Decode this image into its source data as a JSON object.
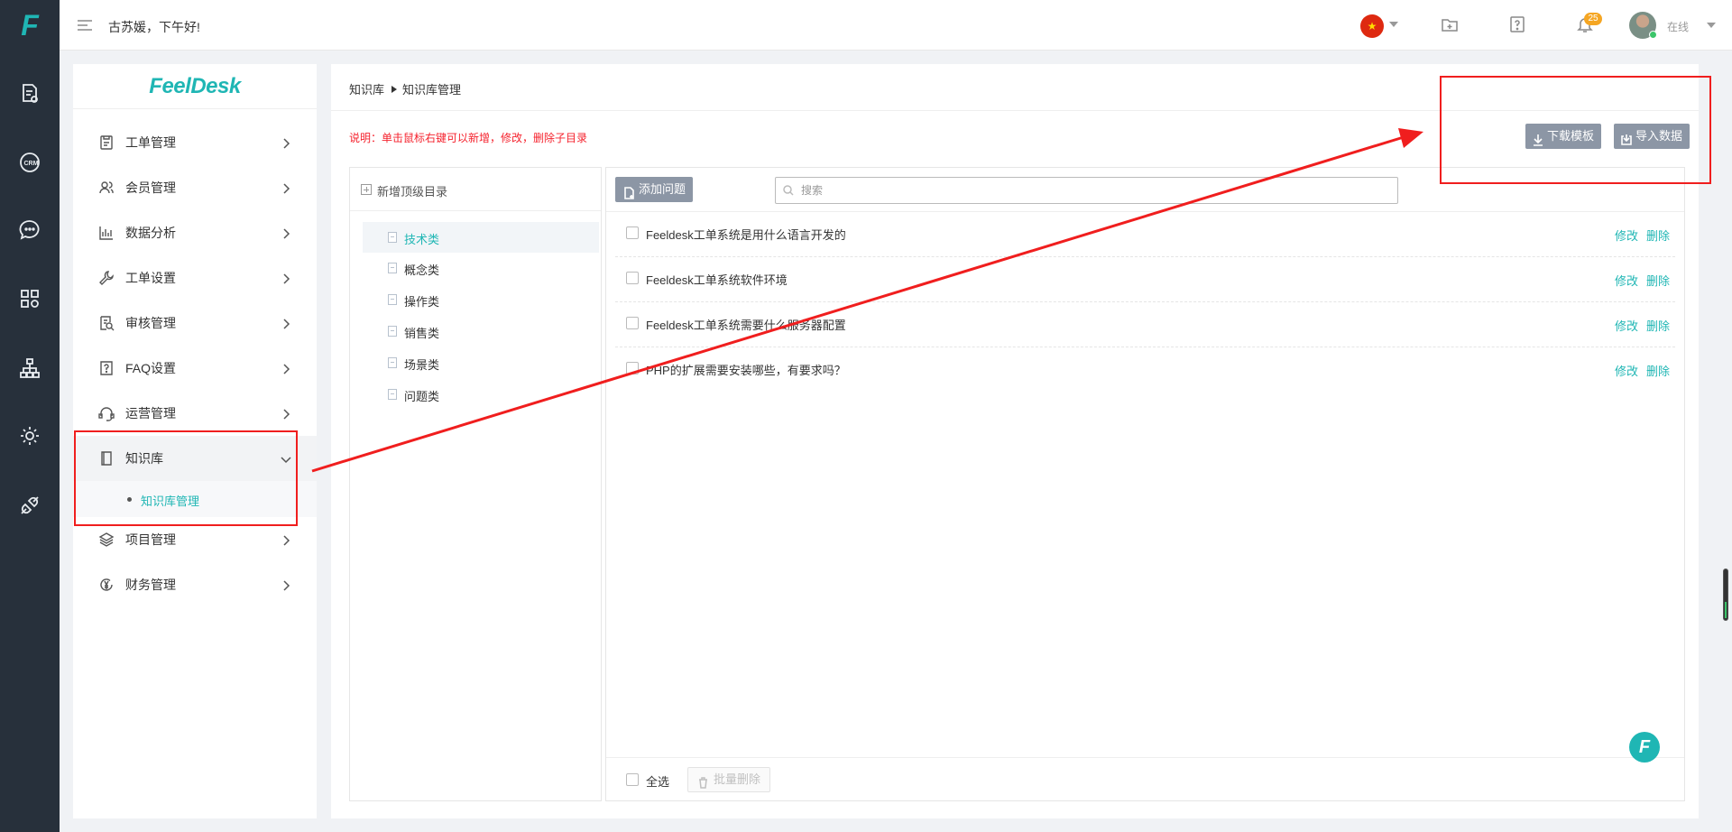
{
  "app": {
    "logo_letter": "F",
    "brand": "FeelDesk",
    "greeting": "古苏媛，下午好!"
  },
  "rail": {
    "items": [
      {
        "icon": "ticket-settings-icon"
      },
      {
        "icon": "crm-icon"
      },
      {
        "icon": "chat-bubble-icon"
      },
      {
        "icon": "apps-grid-icon"
      },
      {
        "icon": "org-tree-icon"
      },
      {
        "icon": "gear-icon"
      },
      {
        "icon": "plug-icon"
      }
    ]
  },
  "topbar": {
    "language_flag": "★",
    "notification_count": "25",
    "user_status": "在线"
  },
  "sidebar": {
    "items": [
      {
        "label": "工单管理",
        "icon": "ticket-icon"
      },
      {
        "label": "会员管理",
        "icon": "members-icon"
      },
      {
        "label": "数据分析",
        "icon": "bar-chart-icon"
      },
      {
        "label": "工单设置",
        "icon": "wrench-icon"
      },
      {
        "label": "审核管理",
        "icon": "audit-icon"
      },
      {
        "label": "FAQ设置",
        "icon": "faq-icon"
      },
      {
        "label": "运营管理",
        "icon": "operations-icon"
      },
      {
        "label": "知识库",
        "icon": "book-icon",
        "expanded": true,
        "sub": [
          {
            "label": "知识库管理",
            "active": true
          }
        ]
      },
      {
        "label": "项目管理",
        "icon": "layers-icon"
      },
      {
        "label": "财务管理",
        "icon": "yen-icon"
      }
    ]
  },
  "main": {
    "breadcrumb": [
      "知识库",
      "知识库管理"
    ],
    "notice": "说明：单击鼠标右键可以新增，修改，删除子目录",
    "download_template_label": "下载模板",
    "import_data_label": "导入数据",
    "tree": {
      "add_root_label": "新增顶级目录",
      "nodes": [
        {
          "label": "技术类",
          "selected": true
        },
        {
          "label": "概念类"
        },
        {
          "label": "操作类"
        },
        {
          "label": "销售类"
        },
        {
          "label": "场景类"
        },
        {
          "label": "问题类"
        }
      ]
    },
    "questions": {
      "add_label": "添加问题",
      "search_placeholder": "搜索",
      "edit_label": "修改",
      "delete_label": "删除",
      "rows": [
        "Feeldesk工单系统是用什么语言开发的",
        "Feeldesk工单系统软件环境",
        "Feeldesk工单系统需要什么服务器配置",
        "PHP的扩展需要安装哪些，有要求吗？"
      ],
      "select_all_label": "全选",
      "bulk_delete_label": "批量删除"
    }
  },
  "colors": {
    "accent": "#1fb6b4",
    "rail_bg": "#27303b",
    "annotation": "#f01e1e",
    "button_gray": "#8c96a5",
    "notice_red": "#f5222d"
  }
}
